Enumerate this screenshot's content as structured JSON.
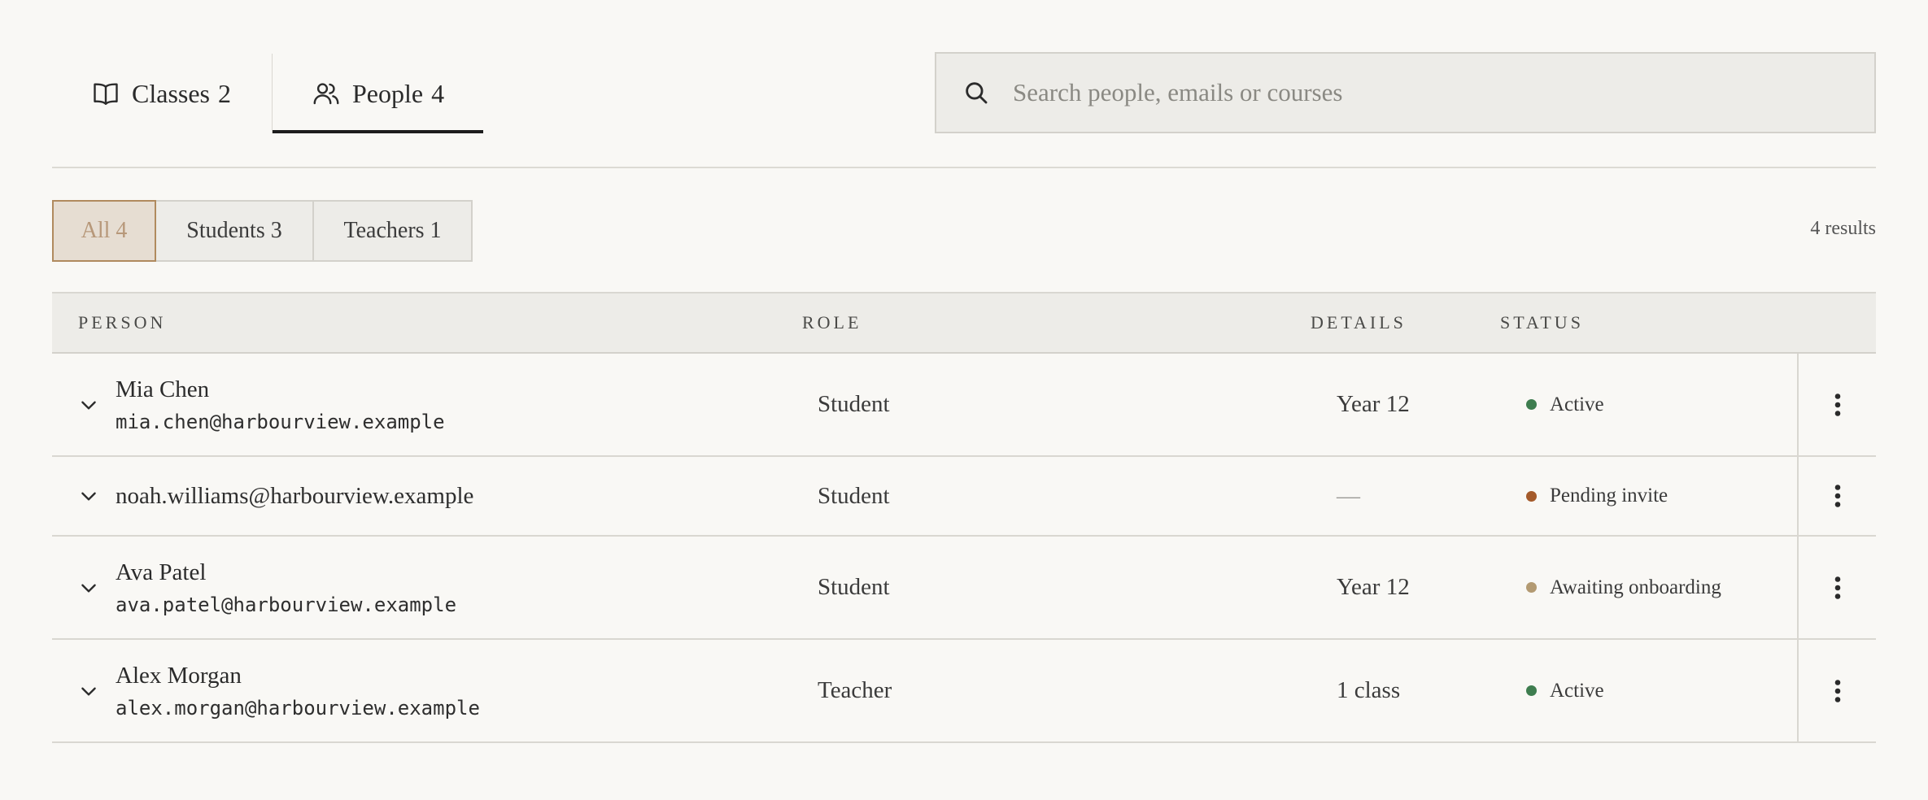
{
  "tabs": [
    {
      "label": "Classes",
      "count": "2",
      "icon": "book-icon",
      "active": false
    },
    {
      "label": "People",
      "count": "4",
      "icon": "people-icon",
      "active": true
    }
  ],
  "search": {
    "placeholder": "Search people, emails or courses",
    "value": "",
    "icon": "search-icon"
  },
  "filters": [
    {
      "label": "All 4",
      "selected": true
    },
    {
      "label": "Students 3",
      "selected": false
    },
    {
      "label": "Teachers 1",
      "selected": false
    }
  ],
  "results_text": "4 results",
  "table": {
    "headers": {
      "person": "PERSON",
      "role": "ROLE",
      "details": "DETAILS",
      "status": "STATUS"
    },
    "rows": [
      {
        "name": "Mia Chen",
        "email": "mia.chen@harbourview.example",
        "role": "Student",
        "details": "Year 12",
        "status": "Active",
        "status_color": "#3e7d4f"
      },
      {
        "name": "",
        "email": "noah.williams@harbourview.example",
        "role": "Student",
        "details": "—",
        "status": "Pending invite",
        "status_color": "#a45a2a"
      },
      {
        "name": "Ava Patel",
        "email": "ava.patel@harbourview.example",
        "role": "Student",
        "details": "Year 12",
        "status": "Awaiting onboarding",
        "status_color": "#b39a72"
      },
      {
        "name": "Alex Morgan",
        "email": "alex.morgan@harbourview.example",
        "role": "Teacher",
        "details": "1 class",
        "status": "Active",
        "status_color": "#3e7d4f"
      }
    ]
  },
  "colors": {
    "accent": "#b08a5e",
    "background": "#f9f8f5",
    "active_tab_underline": "#1d1d1d"
  }
}
